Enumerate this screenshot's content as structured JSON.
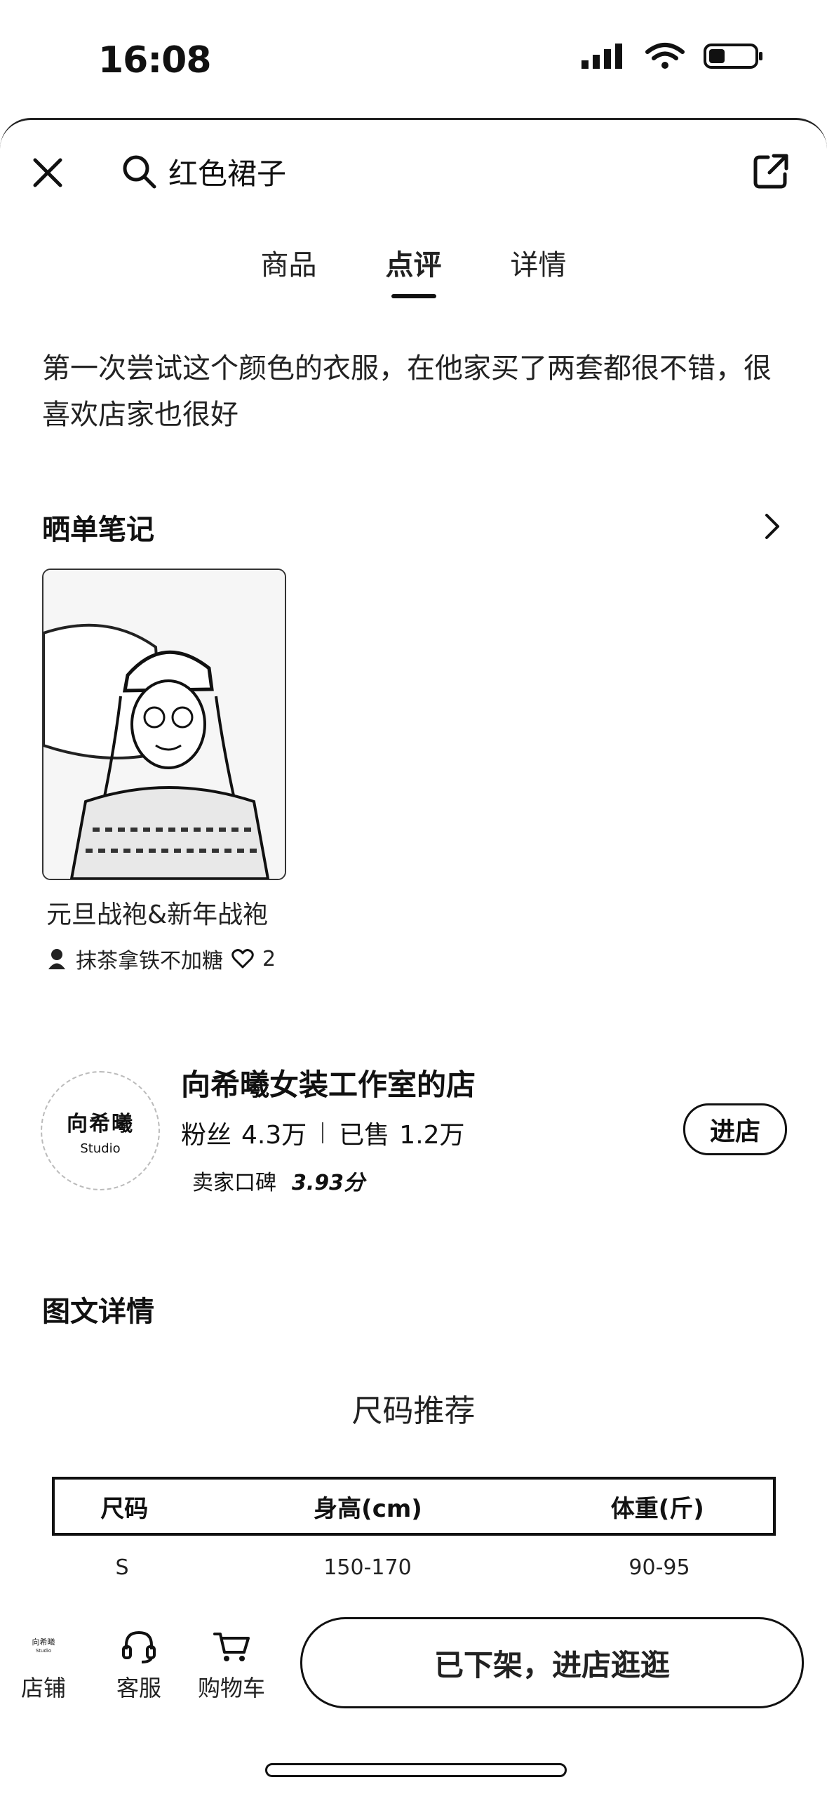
{
  "status_bar": {
    "time": "16:08"
  },
  "search": {
    "query": "红色裙子"
  },
  "tabs": [
    {
      "label": "商品",
      "active": false
    },
    {
      "label": "点评",
      "active": true
    },
    {
      "label": "详情",
      "active": false
    }
  ],
  "review": {
    "text": "第一次尝试这个颜色的衣服，在他家买了两套都很不错，很喜欢店家也很好"
  },
  "notes": {
    "title": "晒单笔记",
    "items": [
      {
        "caption": "元旦战袍&新年战袍",
        "author": "抹茶拿铁不加糖",
        "likes": "2"
      }
    ]
  },
  "shop": {
    "logo_line1": "向希曦",
    "logo_line2": "Studio",
    "name": "向希曦女装工作室的店",
    "fans_label": "粉丝",
    "fans_value": "4.3万",
    "sold_label": "已售",
    "sold_value": "1.2万",
    "rating_label": "卖家口碑",
    "rating_value": "3.93分",
    "enter_label": "进店"
  },
  "detail": {
    "title": "图文详情",
    "size_heading": "尺码推荐",
    "table": {
      "headers": [
        "尺码",
        "身高(cm)",
        "体重(斤)"
      ],
      "rows": [
        [
          "S",
          "150-170",
          "90-95"
        ]
      ]
    }
  },
  "bottom_bar": {
    "shop_label": "店铺",
    "mini_logo_line1": "向希曦",
    "mini_logo_line2": "Studio",
    "service_label": "客服",
    "cart_label": "购物车",
    "action_label": "已下架，进店逛逛"
  }
}
